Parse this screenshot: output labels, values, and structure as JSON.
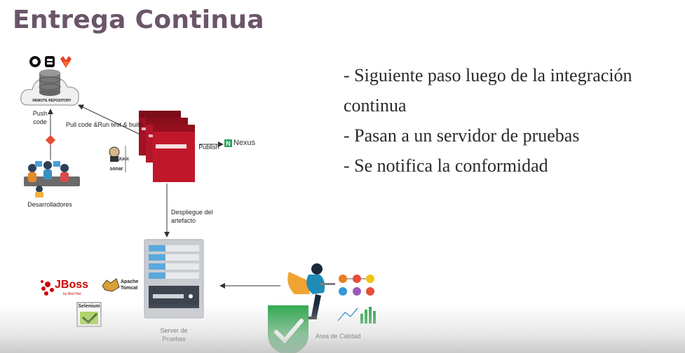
{
  "slide": {
    "title": "Entrega Continua",
    "bullets": [
      "- Siguiente paso luego de la integración",
      "continua",
      "- Pasan a un servidor de pruebas",
      "- Se notifica la conformidad"
    ]
  },
  "diagram": {
    "repo_label": "REMOTE REPOSITORY",
    "push_code": "Push\ncode",
    "pull_code": "Pull code &Run test & build",
    "publish": "Publish",
    "nexus": "Nexus",
    "nexus_mark": "N",
    "developers": "Desarrolladores",
    "deploy": "Despliegue del\nartefacto",
    "server": "Server de\nPruebas",
    "quality": "Area de Calidad",
    "junit": "JUnit",
    "sonar": "sonar",
    "jboss": "JBoss",
    "jboss_sub": "by Red Hat",
    "tomcat": "Apache\nTomcat",
    "selenium": "Selenium"
  },
  "colors": {
    "title": "#6b5569",
    "server_red": "#c0182a",
    "server_gray": "#c9ccd1",
    "server_blue": "#5aa9dc",
    "check_green": "#2fa84f"
  }
}
